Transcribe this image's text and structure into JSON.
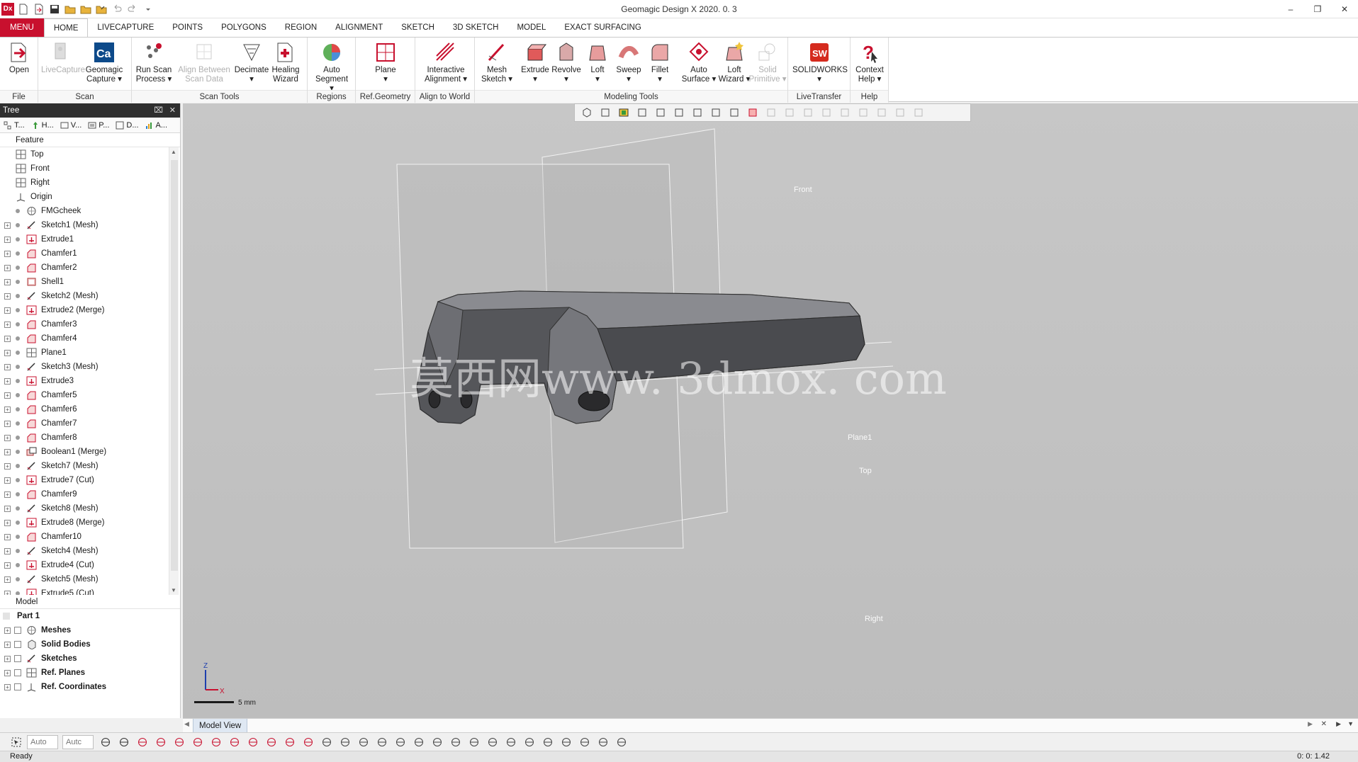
{
  "window": {
    "title": "Geomagic Design X 2020. 0. 3",
    "app_logo": "Dx"
  },
  "tabs": [
    "MENU",
    "HOME",
    "LIVECAPTURE",
    "POINTS",
    "POLYGONS",
    "REGION",
    "ALIGNMENT",
    "SKETCH",
    "3D SKETCH",
    "MODEL",
    "EXACT SURFACING"
  ],
  "ribbon": {
    "groups": {
      "file": "File",
      "scan": "Scan",
      "scan_tools": "Scan Tools",
      "regions": "Regions",
      "ref_geometry": "Ref.Geometry",
      "align_world": "Align to World",
      "modeling_tools": "Modeling Tools",
      "livetransfer": "LiveTransfer",
      "help": "Help"
    },
    "buttons": {
      "open": "Open",
      "livecapture": "LiveCapture",
      "geomagic_capture": "Geomagic\nCapture ▾",
      "run_scan": "Run Scan\nProcess ▾",
      "align_between": "Align Between\nScan Data",
      "decimate": "Decimate\n▾",
      "healing": "Healing\nWizard",
      "auto_segment": "Auto\nSegment ▾",
      "plane": "Plane\n▾",
      "interactive_alignment": "Interactive\nAlignment ▾",
      "mesh_sketch": "Mesh\nSketch ▾",
      "extrude": "Extrude\n▾",
      "revolve": "Revolve\n▾",
      "loft": "Loft\n▾",
      "sweep": "Sweep\n▾",
      "fillet": "Fillet\n▾",
      "auto_surface": "Auto\nSurface ▾",
      "loft_wizard": "Loft\nWizard ▾",
      "solid_primitive": "Solid\nPrimitive ▾",
      "solidworks": "SOLIDWORKS\n▾",
      "context_help": "Context\nHelp ▾"
    }
  },
  "panel": {
    "title": "Tree",
    "tabs": [
      "T...",
      "H...",
      "V...",
      "P...",
      "D...",
      "A..."
    ],
    "feature_label": "Feature",
    "model_label": "Model",
    "feature_items": [
      {
        "label": "Top",
        "icon": "plane-icon",
        "exp": false,
        "dot": false
      },
      {
        "label": "Front",
        "icon": "plane-icon",
        "exp": false,
        "dot": false
      },
      {
        "label": "Right",
        "icon": "plane-icon",
        "exp": false,
        "dot": false
      },
      {
        "label": "Origin",
        "icon": "origin-icon",
        "exp": false,
        "dot": false
      },
      {
        "label": "FMGcheek",
        "icon": "mesh-icon",
        "exp": false,
        "dot": true
      },
      {
        "label": "Sketch1 (Mesh)",
        "icon": "sketch-icon",
        "exp": true,
        "dot": true
      },
      {
        "label": "Extrude1",
        "icon": "extrude-icon",
        "exp": true,
        "dot": true
      },
      {
        "label": "Chamfer1",
        "icon": "chamfer-icon",
        "exp": true,
        "dot": true
      },
      {
        "label": "Chamfer2",
        "icon": "chamfer-icon",
        "exp": true,
        "dot": true
      },
      {
        "label": "Shell1",
        "icon": "shell-icon",
        "exp": true,
        "dot": true
      },
      {
        "label": "Sketch2 (Mesh)",
        "icon": "sketch-icon",
        "exp": true,
        "dot": true
      },
      {
        "label": "Extrude2 (Merge)",
        "icon": "extrude-icon",
        "exp": true,
        "dot": true
      },
      {
        "label": "Chamfer3",
        "icon": "chamfer-icon",
        "exp": true,
        "dot": true
      },
      {
        "label": "Chamfer4",
        "icon": "chamfer-icon",
        "exp": true,
        "dot": true
      },
      {
        "label": "Plane1",
        "icon": "plane-icon",
        "exp": true,
        "dot": true
      },
      {
        "label": "Sketch3 (Mesh)",
        "icon": "sketch-icon",
        "exp": true,
        "dot": true
      },
      {
        "label": "Extrude3",
        "icon": "extrude-icon",
        "exp": true,
        "dot": true
      },
      {
        "label": "Chamfer5",
        "icon": "chamfer-icon",
        "exp": true,
        "dot": true
      },
      {
        "label": "Chamfer6",
        "icon": "chamfer-icon",
        "exp": true,
        "dot": true
      },
      {
        "label": "Chamfer7",
        "icon": "chamfer-icon",
        "exp": true,
        "dot": true
      },
      {
        "label": "Chamfer8",
        "icon": "chamfer-icon",
        "exp": true,
        "dot": true
      },
      {
        "label": "Boolean1 (Merge)",
        "icon": "boolean-icon",
        "exp": true,
        "dot": true
      },
      {
        "label": "Sketch7 (Mesh)",
        "icon": "sketch-icon",
        "exp": true,
        "dot": true
      },
      {
        "label": "Extrude7 (Cut)",
        "icon": "extrude-icon",
        "exp": true,
        "dot": true
      },
      {
        "label": "Chamfer9",
        "icon": "chamfer-icon",
        "exp": true,
        "dot": true
      },
      {
        "label": "Sketch8 (Mesh)",
        "icon": "sketch-icon",
        "exp": true,
        "dot": true
      },
      {
        "label": "Extrude8 (Merge)",
        "icon": "extrude-icon",
        "exp": true,
        "dot": true
      },
      {
        "label": "Chamfer10",
        "icon": "chamfer-icon",
        "exp": true,
        "dot": true
      },
      {
        "label": "Sketch4 (Mesh)",
        "icon": "sketch-icon",
        "exp": true,
        "dot": true
      },
      {
        "label": "Extrude4 (Cut)",
        "icon": "extrude-icon",
        "exp": true,
        "dot": true
      },
      {
        "label": "Sketch5 (Mesh)",
        "icon": "sketch-icon",
        "exp": true,
        "dot": true
      },
      {
        "label": "Extrude5 (Cut)",
        "icon": "extrude-icon",
        "exp": true,
        "dot": true
      }
    ],
    "model_items": [
      {
        "label": "Part 1",
        "icon": "part-icon"
      },
      {
        "label": "Meshes",
        "icon": "mesh-icon"
      },
      {
        "label": "Solid Bodies",
        "icon": "solid-icon"
      },
      {
        "label": "Sketches",
        "icon": "sketch-icon"
      },
      {
        "label": "Ref. Planes",
        "icon": "plane-icon"
      },
      {
        "label": "Ref. Coordinates",
        "icon": "origin-icon"
      }
    ]
  },
  "viewport": {
    "plane_labels": {
      "front": "Front",
      "plane1": "Plane1",
      "top": "Top",
      "right": "Right"
    },
    "watermark": "莫西网www. 3dmox. com",
    "axis_z": "Z",
    "axis_x": "X",
    "scale": "5 mm",
    "view_tab": "Model View"
  },
  "bottom": {
    "combo1": "Auto",
    "combo2": "Autc"
  },
  "status": {
    "left": "Ready",
    "right": "0: 0: 1.42"
  },
  "colors": {
    "accent": "#c8102e",
    "viewport_bg": "#c2c2c2",
    "part": "#5a5a5e"
  }
}
